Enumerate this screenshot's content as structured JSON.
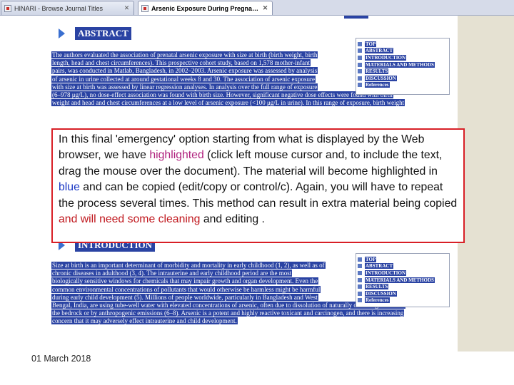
{
  "browser": {
    "tabs": [
      {
        "title": "HINARI - Browse Journal Titles",
        "active": false
      },
      {
        "title": "Arsenic Exposure During Pregnan...",
        "active": true
      }
    ],
    "close_glyph": "✕"
  },
  "article": {
    "abstract": {
      "heading": "ABSTRACT",
      "lines": [
        "The authors evaluated the association of prenatal arsenic exposure with size at birth (birth weight, birth",
        "length, head and chest circumferences). This prospective cohort study, based on 1,578 mother-infant",
        "pairs, was conducted in Matlab, Bangladesh, in 2002–2003. Arsenic exposure was assessed by analysis",
        "of arsenic in urine collected at around gestational weeks 8 and 30. The association of arsenic exposure",
        "with size at birth was assessed by linear regression analyses. In analysis over the full range of exposure",
        "(6–978 μg/L), no dose-effect association was found with birth size. However, significant negative dose effects were found with birth",
        "weight and head and chest circumferences at a low level of arsenic exposure (<100 μg/L in urine). In this range of exposure, birth weight"
      ]
    },
    "introduction": {
      "heading": "INTRODUCTION",
      "lines": [
        "Size at birth is an important determinant of morbidity and mortality in early childhood (1, 2), as well as of",
        "chronic diseases in adulthood (3, 4). The intrauterine and early childhood period are the most",
        "biologically sensitive windows for chemicals that may impair growth and organ development. Even the",
        "common environmental concentrations of pollutants that would otherwise be harmless might be harmful",
        "during early child development (5). Millions of people worldwide, particularly in Bangladesh and West",
        "Bengal, India, are using tube-well water with elevated concentrations of arsenic, often due to dissolution of naturally occurring arsenic in",
        "the bedrock or by anthropogenic emissions (6–8). Arsenic is a potent and highly reactive toxicant and carcinogen, and there is increasing",
        "concern that it may adversely effect intrauterine and child development."
      ]
    },
    "toc": [
      "TOP",
      "ABSTRACT",
      "INTRODUCTION",
      "MATERIALS AND METHODS",
      "RESULTS",
      "DISCUSSION",
      "References"
    ]
  },
  "callout": {
    "before_highlight": "In this final 'emergency' option starting from what is displayed by the Web browser, we have ",
    "highlighted_word": "highlighted",
    "after_highlight": " (click left mouse cursor and, to include the text, drag the mouse over the document).  The material will become highlighted in ",
    "blue_word": "blue",
    "after_blue": " and can be copied (edit/copy or control/c).  Again, you will have to repeat the process several times.  This method can result in extra material being copied ",
    "red_phrase": "and will need some cleaning",
    "ending": " and editing ."
  },
  "footer": {
    "date": "01 March 2018"
  },
  "colors": {
    "selection": "#2a43a3",
    "callout_border": "#d81f26",
    "highlight_pink": "#b0217e",
    "highlight_blue": "#1a38c5",
    "highlight_red": "#c0171d"
  }
}
